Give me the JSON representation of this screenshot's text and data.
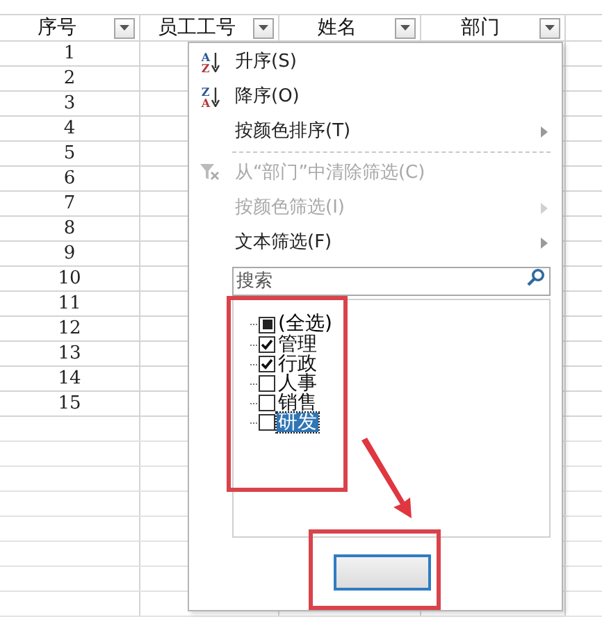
{
  "columns": [
    {
      "label": "序号"
    },
    {
      "label": "员工工号"
    },
    {
      "label": "姓名"
    },
    {
      "label": "部门"
    }
  ],
  "rows": [
    "1",
    "2",
    "3",
    "4",
    "5",
    "6",
    "7",
    "8",
    "9",
    "10",
    "11",
    "12",
    "13",
    "14",
    "15"
  ],
  "menu": {
    "items": [
      {
        "kind": "sort-ascending",
        "icon_letters": [
          "A",
          "Z"
        ],
        "label": "升序(S)",
        "disabled": false,
        "submenu": false
      },
      {
        "kind": "sort-descending",
        "icon_letters": [
          "Z",
          "A"
        ],
        "label": "降序(O)",
        "disabled": false,
        "submenu": false
      },
      {
        "kind": "plain",
        "label": "按颜色排序(T)",
        "disabled": false,
        "submenu": true
      },
      {
        "kind": "separator"
      },
      {
        "kind": "clear-filter",
        "label": "从“部门”中清除筛选(C)",
        "disabled": true,
        "submenu": false
      },
      {
        "kind": "plain",
        "label": "按颜色筛选(I)",
        "disabled": true,
        "submenu": true
      },
      {
        "kind": "plain",
        "label": "文本筛选(F)",
        "disabled": false,
        "submenu": true
      }
    ]
  },
  "search": {
    "placeholder": "搜索"
  },
  "select_all": {
    "label": "(全选)",
    "checked": false,
    "indeterminate": true
  },
  "options": [
    {
      "label": "管理",
      "checked": true,
      "selected": false
    },
    {
      "label": "行政",
      "checked": true,
      "selected": false
    },
    {
      "label": "人事",
      "checked": false,
      "selected": false
    },
    {
      "label": "销售",
      "checked": false,
      "selected": false
    },
    {
      "label": "研发",
      "checked": false,
      "selected": true
    }
  ]
}
